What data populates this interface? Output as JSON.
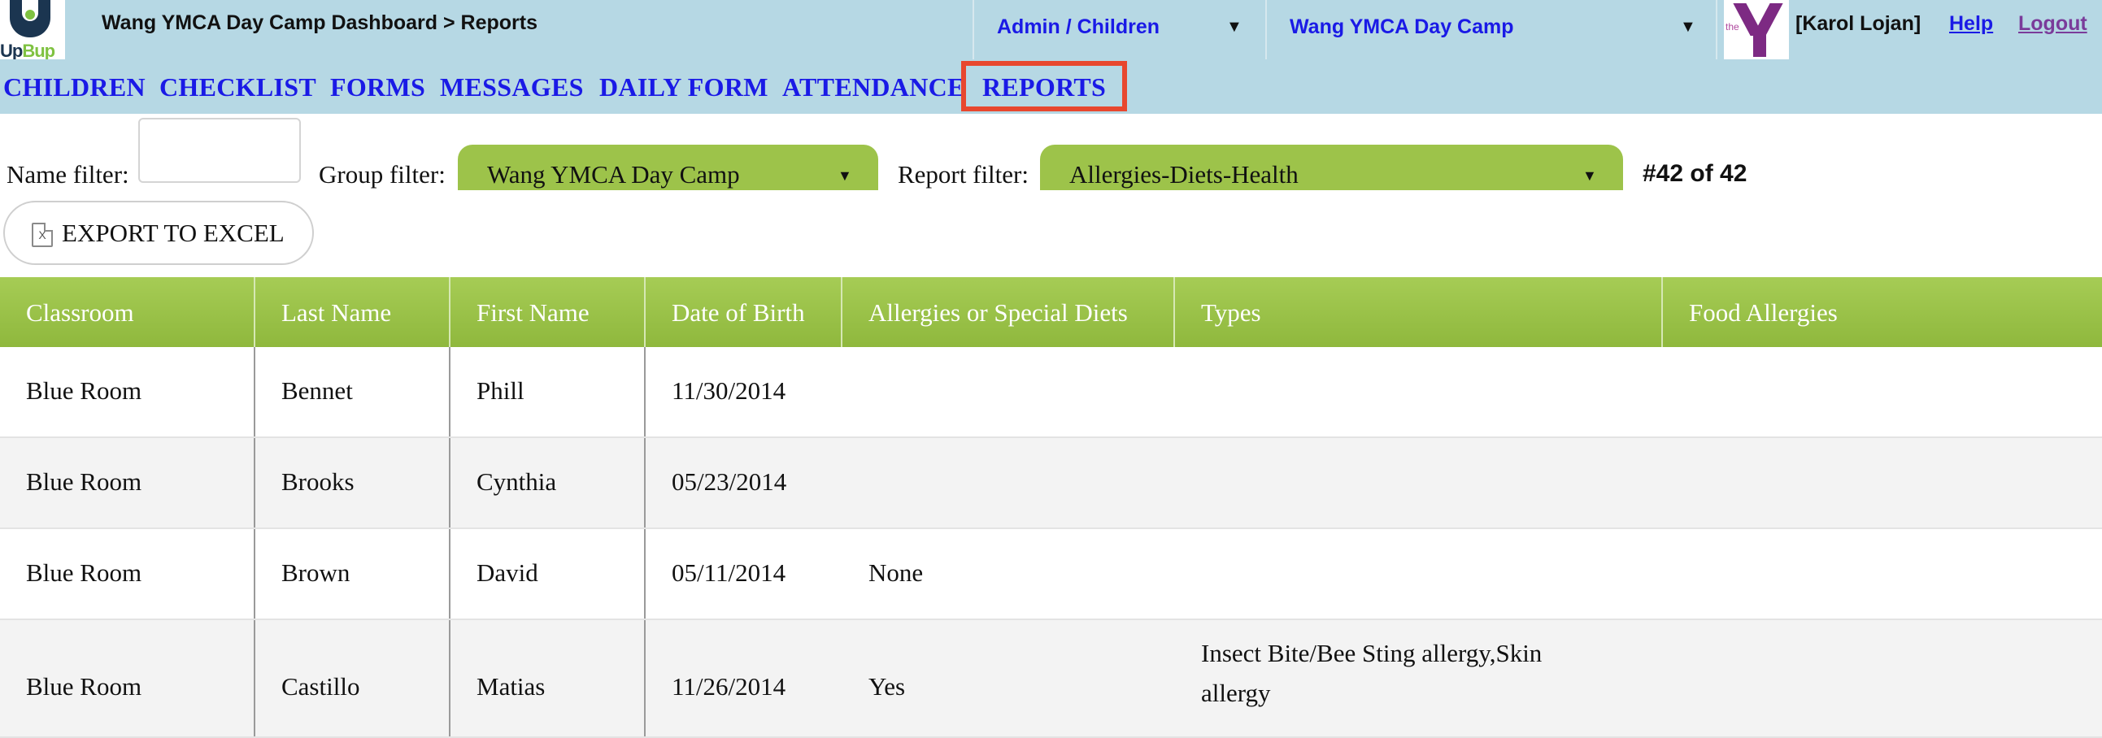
{
  "header": {
    "logo_text_part1": "Up",
    "logo_text_part2": "Bup",
    "breadcrumb": "Wang YMCA Day Camp Dashboard > Reports",
    "role_select": "Admin / Children",
    "camp_select": "Wang YMCA Day Camp",
    "ymca_logo_text": "the",
    "user_name": "[Karol Lojan]",
    "help": "Help",
    "logout": "Logout"
  },
  "nav": {
    "items": [
      "CHILDREN",
      "CHECKLIST",
      "FORMS",
      "MESSAGES",
      "DAILY FORM",
      "ATTENDANCE",
      "REPORTS"
    ],
    "active": "REPORTS",
    "highlight_color": "#e8472e"
  },
  "filters": {
    "name_label": "Name filter:",
    "name_value": "",
    "group_label": "Group filter:",
    "group_value": "Wang YMCA Day Camp",
    "report_label": "Report filter:",
    "report_value": "Allergies-Diets-Health",
    "record_count": "#42 of 42"
  },
  "export": {
    "icon_letter": "X",
    "label": "EXPORT TO EXCEL"
  },
  "table": {
    "columns": [
      "Classroom",
      "Last Name",
      "First Name",
      "Date of Birth",
      "Allergies or Special Diets",
      "Types",
      "Food Allergies"
    ],
    "rows": [
      [
        "Blue Room",
        "Bennet",
        "Phill",
        "11/30/2014",
        "",
        "",
        ""
      ],
      [
        "Blue Room",
        "Brooks",
        "Cynthia",
        "05/23/2014",
        "",
        "",
        ""
      ],
      [
        "Blue Room",
        "Brown",
        "David",
        "05/11/2014",
        "None",
        "",
        ""
      ],
      [
        "Blue Room",
        "Castillo",
        "Matias",
        "11/26/2014",
        "Yes",
        "Insect Bite/Bee Sting allergy,Skin allergy",
        ""
      ]
    ]
  },
  "colors": {
    "header_bg": "#b6d8e4",
    "link_blue": "#1a1ae6",
    "table_header_green": "#9dc34a"
  }
}
